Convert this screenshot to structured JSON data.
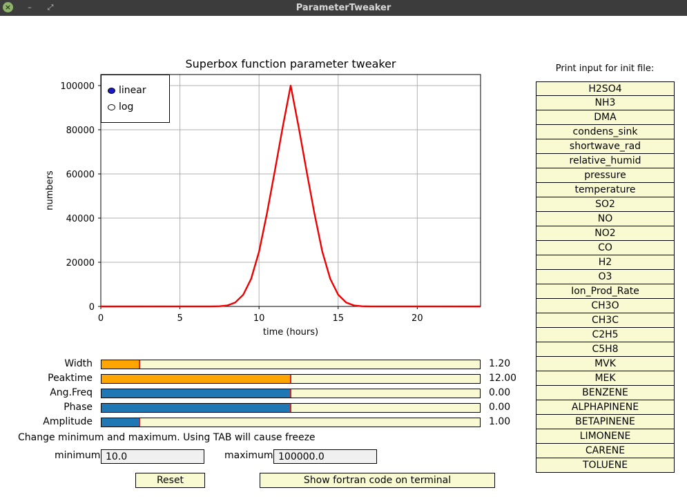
{
  "window": {
    "title": "ParameterTweaker"
  },
  "chart_data": {
    "type": "line",
    "title": "Superbox function parameter tweaker",
    "xlabel": "time (hours)",
    "ylabel": "numbers",
    "xlim": [
      0,
      24
    ],
    "ylim": [
      0,
      105000
    ],
    "xticks": [
      0,
      5,
      10,
      15,
      20
    ],
    "yticks": [
      0,
      20000,
      40000,
      60000,
      80000,
      100000
    ],
    "grid": true,
    "legend_placement": "top-left",
    "series_color": "#ee0000",
    "x": [
      0,
      7,
      7.5,
      8,
      8.5,
      9,
      9.5,
      10,
      10.5,
      11,
      11.5,
      12,
      12.5,
      13,
      13.5,
      14,
      14.5,
      15,
      15.5,
      16,
      16.5,
      17,
      24
    ],
    "y": [
      10,
      20,
      80,
      450,
      1800,
      5300,
      12500,
      24800,
      42100,
      61500,
      81300,
      100000,
      81300,
      61500,
      42100,
      24800,
      12500,
      5300,
      1800,
      450,
      80,
      20,
      10
    ]
  },
  "legend": {
    "options": [
      {
        "label": "linear",
        "selected": true
      },
      {
        "label": "log",
        "selected": false
      }
    ]
  },
  "sliders": [
    {
      "label": "Width",
      "value_text": "1.20",
      "fill_fraction": 0.1,
      "fill_color": "#ffa500"
    },
    {
      "label": "Peaktime",
      "value_text": "12.00",
      "fill_fraction": 0.5,
      "fill_color": "#ffa500"
    },
    {
      "label": "Ang.Freq",
      "value_text": "0.00",
      "fill_fraction": 0.5,
      "fill_color": "#1f77b4"
    },
    {
      "label": "Phase",
      "value_text": "0.00",
      "fill_fraction": 0.5,
      "fill_color": "#1f77b4"
    },
    {
      "label": "Amplitude",
      "value_text": "1.00",
      "fill_fraction": 0.1,
      "fill_color": "#1f77b4"
    }
  ],
  "range": {
    "note": "Change minimum and maximum. Using TAB will cause freeze",
    "minimum_label": "minimum",
    "minimum_value": "10.0",
    "maximum_label": "maximum",
    "maximum_value": "100000.0"
  },
  "buttons": {
    "reset": "Reset",
    "show_fortran": "Show fortran code on terminal"
  },
  "print_panel": {
    "header": "Print input for init file:",
    "items": [
      "H2SO4",
      "NH3",
      "DMA",
      "condens_sink",
      "shortwave_rad",
      "relative_humid",
      "pressure",
      "temperature",
      "SO2",
      "NO",
      "NO2",
      "CO",
      "H2",
      "O3",
      "Ion_Prod_Rate",
      "CH3O",
      "CH3C",
      "C2H5",
      "C5H8",
      "MVK",
      "MEK",
      "BENZENE",
      "ALPHAPINENE",
      "BETAPINENE",
      "LIMONENE",
      "CARENE",
      "TOLUENE"
    ]
  }
}
